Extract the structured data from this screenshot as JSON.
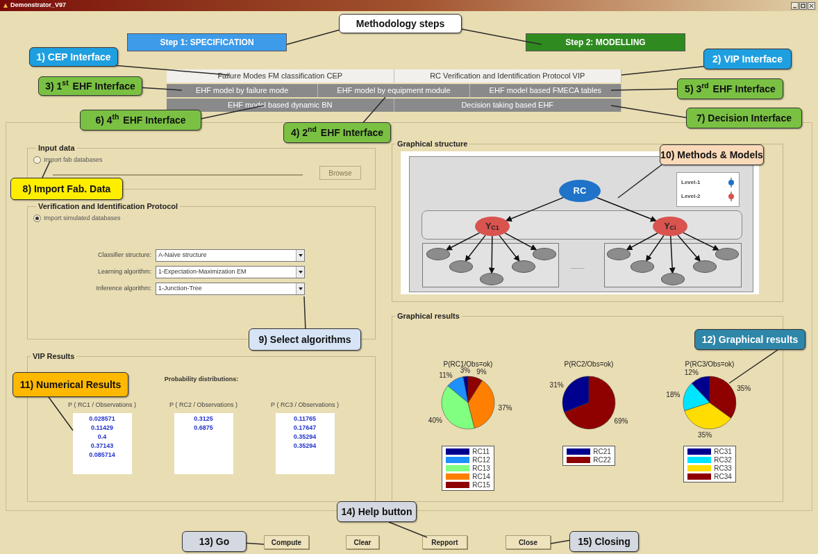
{
  "window": {
    "title": "Demonstrator_V97"
  },
  "steps": [
    {
      "label": "Step 1: SPECIFICATION",
      "color": "#3d9be9"
    },
    {
      "label": "Step 2: MODELLING",
      "color": "#2f8a1f"
    }
  ],
  "interface_rows": [
    [
      {
        "label": "Failure Modes FM classification CEP",
        "kind": "light"
      },
      {
        "label": "RC Verification and Identification Protocol VIP",
        "kind": "light"
      }
    ],
    [
      {
        "label": "EHF model by failure mode",
        "kind": "dark"
      },
      {
        "label": "EHF model by equipment module",
        "kind": "dark"
      },
      {
        "label": "EHF model based FMECA tables",
        "kind": "dark"
      }
    ],
    [
      {
        "label": "EHF model based dynamic BN",
        "kind": "dark"
      },
      {
        "label": "Decision taking based EHF",
        "kind": "dark"
      }
    ]
  ],
  "input_data": {
    "title": "Input data",
    "option": {
      "label": "Import fab databases",
      "selected": false
    },
    "browse_button": {
      "label": "Browse",
      "disabled": true
    }
  },
  "protocol": {
    "title": "Verification and Identification Protocol",
    "option": {
      "label": "Import simulated databases",
      "selected": true
    },
    "fields": [
      {
        "label": "Classifier structure:",
        "value": "A-Naive structure"
      },
      {
        "label": "Learning algorithm:",
        "value": "1-Expectation-Maximization EM"
      },
      {
        "label": "Inference algorithm:",
        "value": "1-Junction-Tree"
      }
    ]
  },
  "vip_results": {
    "title": "VIP Results",
    "subtitle": "Probability distributions:",
    "columns": [
      {
        "header": "P ( RC1 / Observations )",
        "values": [
          "0.028571",
          "0.11429",
          "0.4",
          "0.37143",
          "0.085714"
        ]
      },
      {
        "header": "P ( RC2 / Observations )",
        "values": [
          "0.3125",
          "0.6875"
        ]
      },
      {
        "header": "P ( RC3 / Observations )",
        "values": [
          "0.11765",
          "0.17647",
          "0.35294",
          "0.35294"
        ]
      }
    ]
  },
  "graphical_structure": {
    "title": "Graphical structure",
    "root": "RC",
    "children": [
      "Y$_{C1}$",
      "Y$_{Ci}$"
    ],
    "ellipsis": "........",
    "legend": [
      {
        "label": "Level-1",
        "color": "#1f73c8"
      },
      {
        "label": "Level-2",
        "color": "#d9534f"
      }
    ]
  },
  "graphical_results": {
    "title": "Graphical results",
    "charts": [
      {
        "chart_data": {
          "type": "pie",
          "title": "P(RC1/Obs=ok)",
          "categories": [
            "RC11",
            "RC12",
            "RC13",
            "RC14",
            "RC15"
          ],
          "values": [
            3,
            11,
            40,
            37,
            9
          ],
          "legend": "bottom",
          "value_labels": [
            "3%",
            "11%",
            "40%",
            "37%",
            "9%"
          ]
        },
        "legend": [
          {
            "color": "#00008f"
          },
          {
            "color": "#1e90ff"
          },
          {
            "color": "#80ff80"
          },
          {
            "color": "#ff8000"
          },
          {
            "color": "#8f0000"
          }
        ]
      },
      {
        "chart_data": {
          "type": "pie",
          "title": "P(RC2/Obs=ok)",
          "categories": [
            "RC21",
            "RC22"
          ],
          "values": [
            31,
            69
          ],
          "legend": "bottom",
          "value_labels": [
            "31%",
            "69%"
          ]
        },
        "legend": [
          {
            "color": "#00008f"
          },
          {
            "color": "#8f0000"
          }
        ]
      },
      {
        "chart_data": {
          "type": "pie",
          "title": "P(RC3/Obs=ok)",
          "categories": [
            "RC31",
            "RC32",
            "RC33",
            "RC34"
          ],
          "values": [
            12,
            18,
            35,
            35
          ],
          "legend": "bottom",
          "value_labels": [
            "12%",
            "18%",
            "35%",
            "35%"
          ]
        },
        "legend": [
          {
            "color": "#00008f"
          },
          {
            "color": "#00e5ff"
          },
          {
            "color": "#ffdd00"
          },
          {
            "color": "#8f0000"
          }
        ]
      }
    ]
  },
  "buttons": [
    {
      "label": "Compute"
    },
    {
      "label": "Clear"
    },
    {
      "label": "Repport"
    },
    {
      "label": "Close"
    }
  ],
  "callouts": [
    {
      "label": "Methodology steps",
      "color": "#ffffff"
    },
    {
      "label": "1) CEP Interface",
      "color": "#1e9fe0"
    },
    {
      "label": "2) VIP Interface",
      "color": "#1e9fe0"
    },
    {
      "label": "3) 1$^{st}$ EHF Interface",
      "color": "#7ac143"
    },
    {
      "label": "5) 3$^{rd}$ EHF Interface",
      "color": "#7ac143"
    },
    {
      "label": "6) 4$^{th}$ EHF Interface",
      "color": "#7ac143"
    },
    {
      "label": "7) Decision Interface",
      "color": "#7ac143"
    },
    {
      "label": "4) 2$^{nd}$ EHF Interface",
      "color": "#7ac143"
    },
    {
      "label": "8) Import Fab. Data",
      "color": "#ffee00"
    },
    {
      "label": "9) Select algorithms",
      "color": "#d6e4f5"
    },
    {
      "label": "10) Methods & Models",
      "color": "#fad9b8"
    },
    {
      "label": "11) Numerical Results",
      "color": "#ffb800"
    },
    {
      "label": "12) Graphical results",
      "color": "#2e86a8"
    },
    {
      "label": "13) Go",
      "color": "#d4d8e0"
    },
    {
      "label": "14) Help button",
      "color": "#d4d8e0"
    },
    {
      "label": "15) Closing",
      "color": "#d4d8e0"
    }
  ]
}
